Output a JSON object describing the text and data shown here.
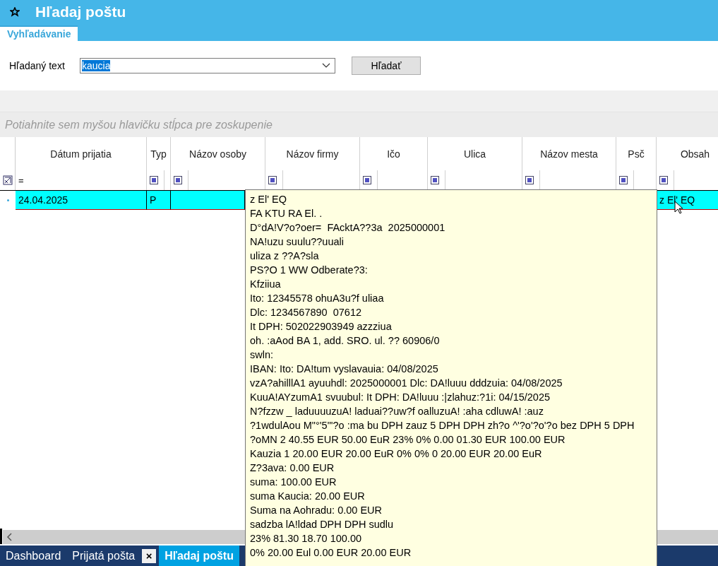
{
  "window": {
    "title": "Hľadaj poštu"
  },
  "tabs": [
    {
      "label": "Vyhľadávanie",
      "selected": true
    }
  ],
  "search": {
    "label": "Hľadaný text",
    "value": "kaucia",
    "button": "Hľadať"
  },
  "group_panel": {
    "placeholder": "Potiahnite sem myšou hlavičku stĺpca pre zoskupenie"
  },
  "table": {
    "columns": [
      {
        "label": "Dátum prijatia",
        "filter": "="
      },
      {
        "label": "Typ"
      },
      {
        "label": "Názov osoby"
      },
      {
        "label": "Názov firmy"
      },
      {
        "label": "Ičo"
      },
      {
        "label": "Ulica"
      },
      {
        "label": "Názov mesta"
      },
      {
        "label": "Psč"
      },
      {
        "label": "Obsah"
      }
    ],
    "rows": [
      {
        "selected": true,
        "date": "24.04.2025",
        "type": "P",
        "content": "z El' EQ"
      }
    ]
  },
  "tooltip": {
    "lines": [
      "z El' EQ",
      "FA KTU RA El. .",
      "D°dA!V?o?oer=  FAcktA??3a  2025000001",
      "NA!uzu suulu??uuali",
      "uliza z ??A?sla",
      "PS?O 1 WW Odberate?3:",
      "Kfziiua",
      "Ito: 12345578 ohuA3u?f uliaa",
      "Dlc: 1234567890  07612",
      "It DPH: 502022903949 azzziua",
      "oh. :aAod BA 1, add. SRO. ul. ?? 60906/0",
      "swln:",
      "IBAN: Ito: DA!tum vyslavauia: 04/08/2025",
      "vzA?ahilllA1 ayuuhdl: 2025000001 Dlc: DA!luuu dddzuia: 04/08/2025",
      "KuuA!AYzumA1 svuubul: It DPH: DA!luuu :|zlahuz:?1i: 04/15/2025",
      "N?fzzw _ laduuuuzuA! laduai??uw?f oalluzuA! :aha cdluwA! :auz",
      "?1wdulAou M\"°'5\"'?o :ma bu DPH zauz 5 DPH DPH zh?o ^'?o'?o'?o bez DPH 5 DPH",
      "?oMN 2 40.55 EUR 50.00 EuR 23% 0% 0.00 01.30 EUR 100.00 EUR",
      "Kauzia 1 20.00 EUR 20.00 EuR 0% 0% 0 20.00 EUR 20.00 EuR",
      "Z?3ava: 0.00 EUR",
      "suma: 100.00 EUR",
      "suma Kaucia: 20.00 EUR",
      "Suma na Aohradu: 0.00 EUR",
      "sadzba lA!ldad DPH DPH sudlu",
      "23% 81.30 18.70 100.00",
      "0% 20.00 Eul 0.00 EUR 20.00 EUR"
    ]
  },
  "doc_tabs": [
    {
      "label": "Dashboard",
      "selected": false
    },
    {
      "label": "Prijatá pošta",
      "selected": false,
      "close": "×"
    },
    {
      "label": "Hľadaj poštu",
      "selected": true
    }
  ]
}
